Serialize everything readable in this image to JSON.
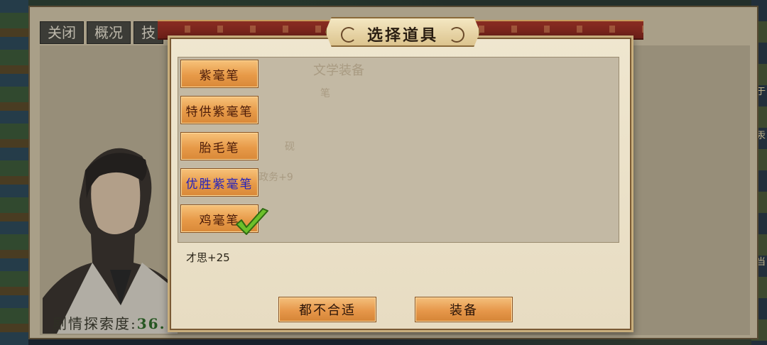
{
  "background": {
    "tabs": [
      "关闭",
      "概况",
      "技"
    ],
    "progress_label": "剧情探索度:",
    "progress_value": "36.",
    "right_edge_chars": [
      "于",
      "汞",
      "当"
    ]
  },
  "dialog": {
    "title": "选择道具",
    "items": [
      {
        "label": "紫毫笔",
        "color": "#4a1a08",
        "selected": false
      },
      {
        "label": "特供紫毫笔",
        "color": "#4a1a08",
        "selected": false
      },
      {
        "label": "胎毛笔",
        "color": "#4a1a08",
        "selected": false
      },
      {
        "label": "优胜紫毫笔",
        "color": "#1f1fbf",
        "selected": false
      },
      {
        "label": "鸡毫笔",
        "color": "#4a1a08",
        "selected": true
      }
    ],
    "selected_attribute": "才思+25",
    "buttons": {
      "none_suitable": "都不合适",
      "equip": "装备"
    }
  },
  "colors": {
    "banner_red": "#8a2c22",
    "item_orange": "#e79a48",
    "check_green": "#6cc02a"
  }
}
